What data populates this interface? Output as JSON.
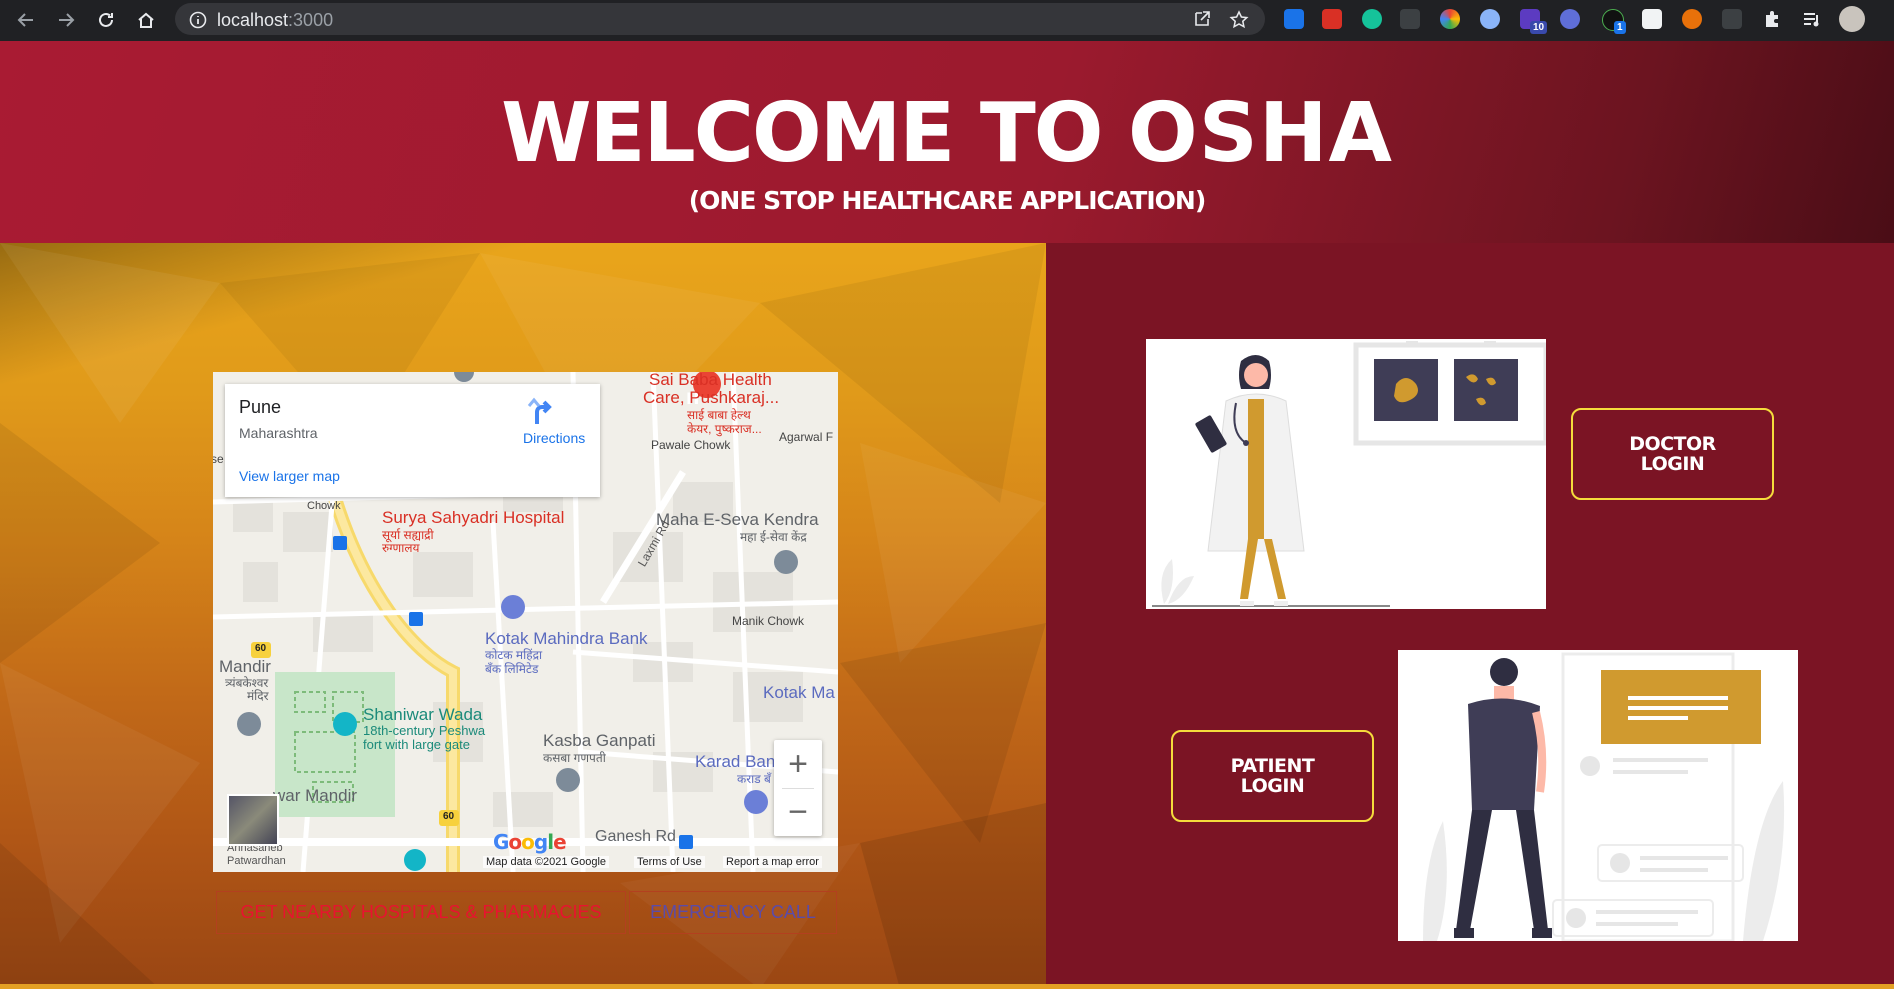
{
  "browser": {
    "url_host": "localhost",
    "url_port": ":3000",
    "ext_badges": [
      "10",
      "1"
    ]
  },
  "header": {
    "title_prefix": "WELCOME TO ",
    "title_brand": "OSHA",
    "subtitle": "(ONE STOP HEALTHCARE APPLICATION)"
  },
  "map": {
    "place_name": "Pune",
    "place_region": "Maharashtra",
    "directions_label": "Directions",
    "larger_map_link": "View larger map",
    "labels": {
      "sai_baba_1": "Sai Baba Health",
      "sai_baba_2": "Care, Pushkaraj...",
      "sai_baba_3": "साई बाबा हेल्थ",
      "sai_baba_4": "केयर, पुष्कराज...",
      "pawale": "Pawale Chowk",
      "agarwal": "Agarwal F",
      "chowk": "Chowk",
      "surya_1": "Surya Sahyadri Hospital",
      "surya_2": "सूर्या सह्याद्री",
      "surya_3": "रुग्णालय",
      "maha_1": "Maha E-Seva Kendra",
      "maha_2": "महा ई-सेवा केंद्र",
      "laxmi": "Laxmi Rd",
      "manik": "Manik Chowk",
      "kotak_1": "Kotak Mahindra Bank",
      "kotak_2": "कोटक महिंद्रा",
      "kotak_3": "बँक लिमिटेड",
      "kotak_ma": "Kotak Ma",
      "mandir": "Mandir",
      "tryambak_1": "त्र्यंबकेश्वर",
      "tryambak_2": "मंदिर",
      "shaniwar_1": "Shaniwar Wada",
      "shaniwar_2": "18th-century Peshwa",
      "shaniwar_3": "fort with large gate",
      "kasba_1": "Kasba Ganpati",
      "kasba_2": "कसबा गणपती",
      "karad_1": "Karad Ban",
      "karad_2": "कराड बँ",
      "war_mandir": "war Mandir",
      "annasaheb_1": "Annasaheb",
      "annasaheb_2": "Patwardhan",
      "ganesh": "Ganesh Rd",
      "road_60a": "60",
      "road_60b": "60",
      "se": "se"
    },
    "zoom_in": "+",
    "zoom_out": "−",
    "google": "Google",
    "footer": {
      "data": "Map data ©2021 Google",
      "terms": "Terms of Use",
      "report": "Report a map error"
    }
  },
  "actions": {
    "nearby_label": "GET NEARBY HOSPITALS & PHARMACIES",
    "emergency_label": "EMERGENCY CALL"
  },
  "login": {
    "doctor_line1": "DOCTOR",
    "doctor_line2": "LOGIN",
    "patient_line1": "PATIENT",
    "patient_line2": "LOGIN"
  },
  "colors": {
    "header_red": "#a91b33",
    "panel_maroon": "#7b1424",
    "login_border": "#f5dc3c",
    "panel_gold": "#e3a024"
  }
}
